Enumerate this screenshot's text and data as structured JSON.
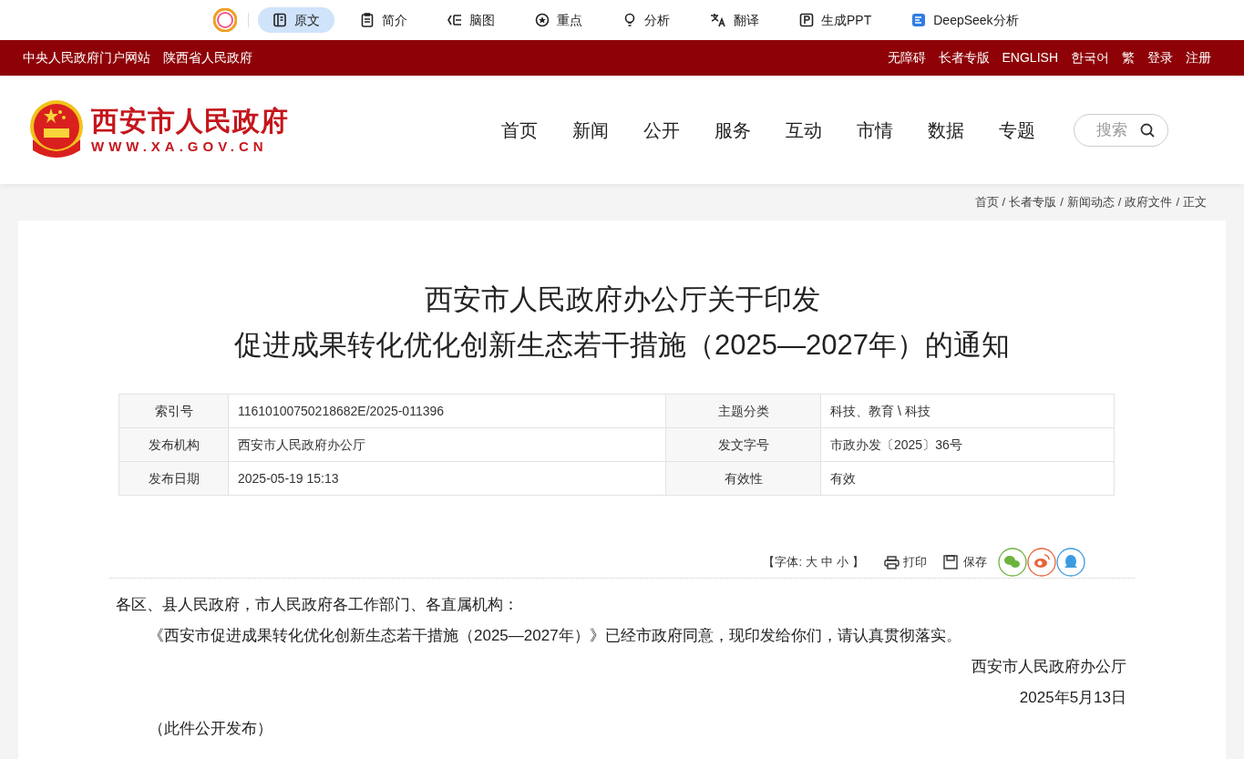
{
  "ai_toolbar": {
    "items": [
      {
        "kind": "doc",
        "label": "原文",
        "selected": true
      },
      {
        "kind": "clipboard",
        "label": "简介",
        "selected": false
      },
      {
        "kind": "mindmap",
        "label": "脑图",
        "selected": false
      },
      {
        "kind": "star",
        "label": "重点",
        "selected": false
      },
      {
        "kind": "bulb",
        "label": "分析",
        "selected": false
      },
      {
        "kind": "translate",
        "label": "翻译",
        "selected": false
      },
      {
        "kind": "ppt",
        "label": "生成PPT",
        "selected": false
      },
      {
        "kind": "deepseek",
        "label": "DeepSeek分析",
        "selected": false
      }
    ]
  },
  "top_bar": {
    "left_links": [
      "中央人民政府门户网站",
      "陕西省人民政府"
    ],
    "right_links": [
      "无障碍",
      "长者专版",
      "ENGLISH",
      "한국어",
      "繁",
      "登录",
      "注册"
    ]
  },
  "header": {
    "logo_title": "西安市人民政府",
    "logo_url": "WWW.XA.GOV.CN",
    "nav": [
      "首页",
      "新闻",
      "公开",
      "服务",
      "互动",
      "市情",
      "数据",
      "专题"
    ],
    "search": {
      "placeholder": "搜索"
    }
  },
  "breadcrumb": [
    {
      "label": "首页",
      "separator": "/"
    },
    {
      "label": "长者专版",
      "separator": "/"
    },
    {
      "label": "新闻动态",
      "separator": "/"
    },
    {
      "label": "政府文件",
      "separator": "/"
    },
    {
      "label": "正文"
    }
  ],
  "article": {
    "title_lines": [
      "西安市人民政府办公厅关于印发",
      "促进成果转化优化创新生态若干措施（2025—2027年）的通知"
    ],
    "meta": [
      [
        {
          "label": "索引号",
          "value": "11610100750218682E/2025-011396"
        },
        {
          "label": "主题分类",
          "value": "科技、教育 \\ 科技"
        }
      ],
      [
        {
          "label": "发布机构",
          "value": "西安市人民政府办公厅"
        },
        {
          "label": "发文字号",
          "value": "市政办发〔2025〕36号"
        }
      ],
      [
        {
          "label": "发布日期",
          "value": "2025-05-19 15:13"
        },
        {
          "label": "有效性",
          "value": "有效"
        }
      ]
    ],
    "tools": {
      "font_prefix": "【字体:",
      "font_sizes": [
        "大",
        "中",
        "小"
      ],
      "font_suffix": "】",
      "print": "打印",
      "save": "保存"
    },
    "salutation": "各区、县人民政府，市人民政府各工作部门、各直属机构：",
    "paragraph": "《西安市促进成果转化优化创新生态若干措施（2025—2027年）》已经市政府同意，现印发给你们，请认真贯彻落实。",
    "signature": "西安市人民政府办公厅",
    "date": "2025年5月13日",
    "note": "（此件公开发布）"
  }
}
